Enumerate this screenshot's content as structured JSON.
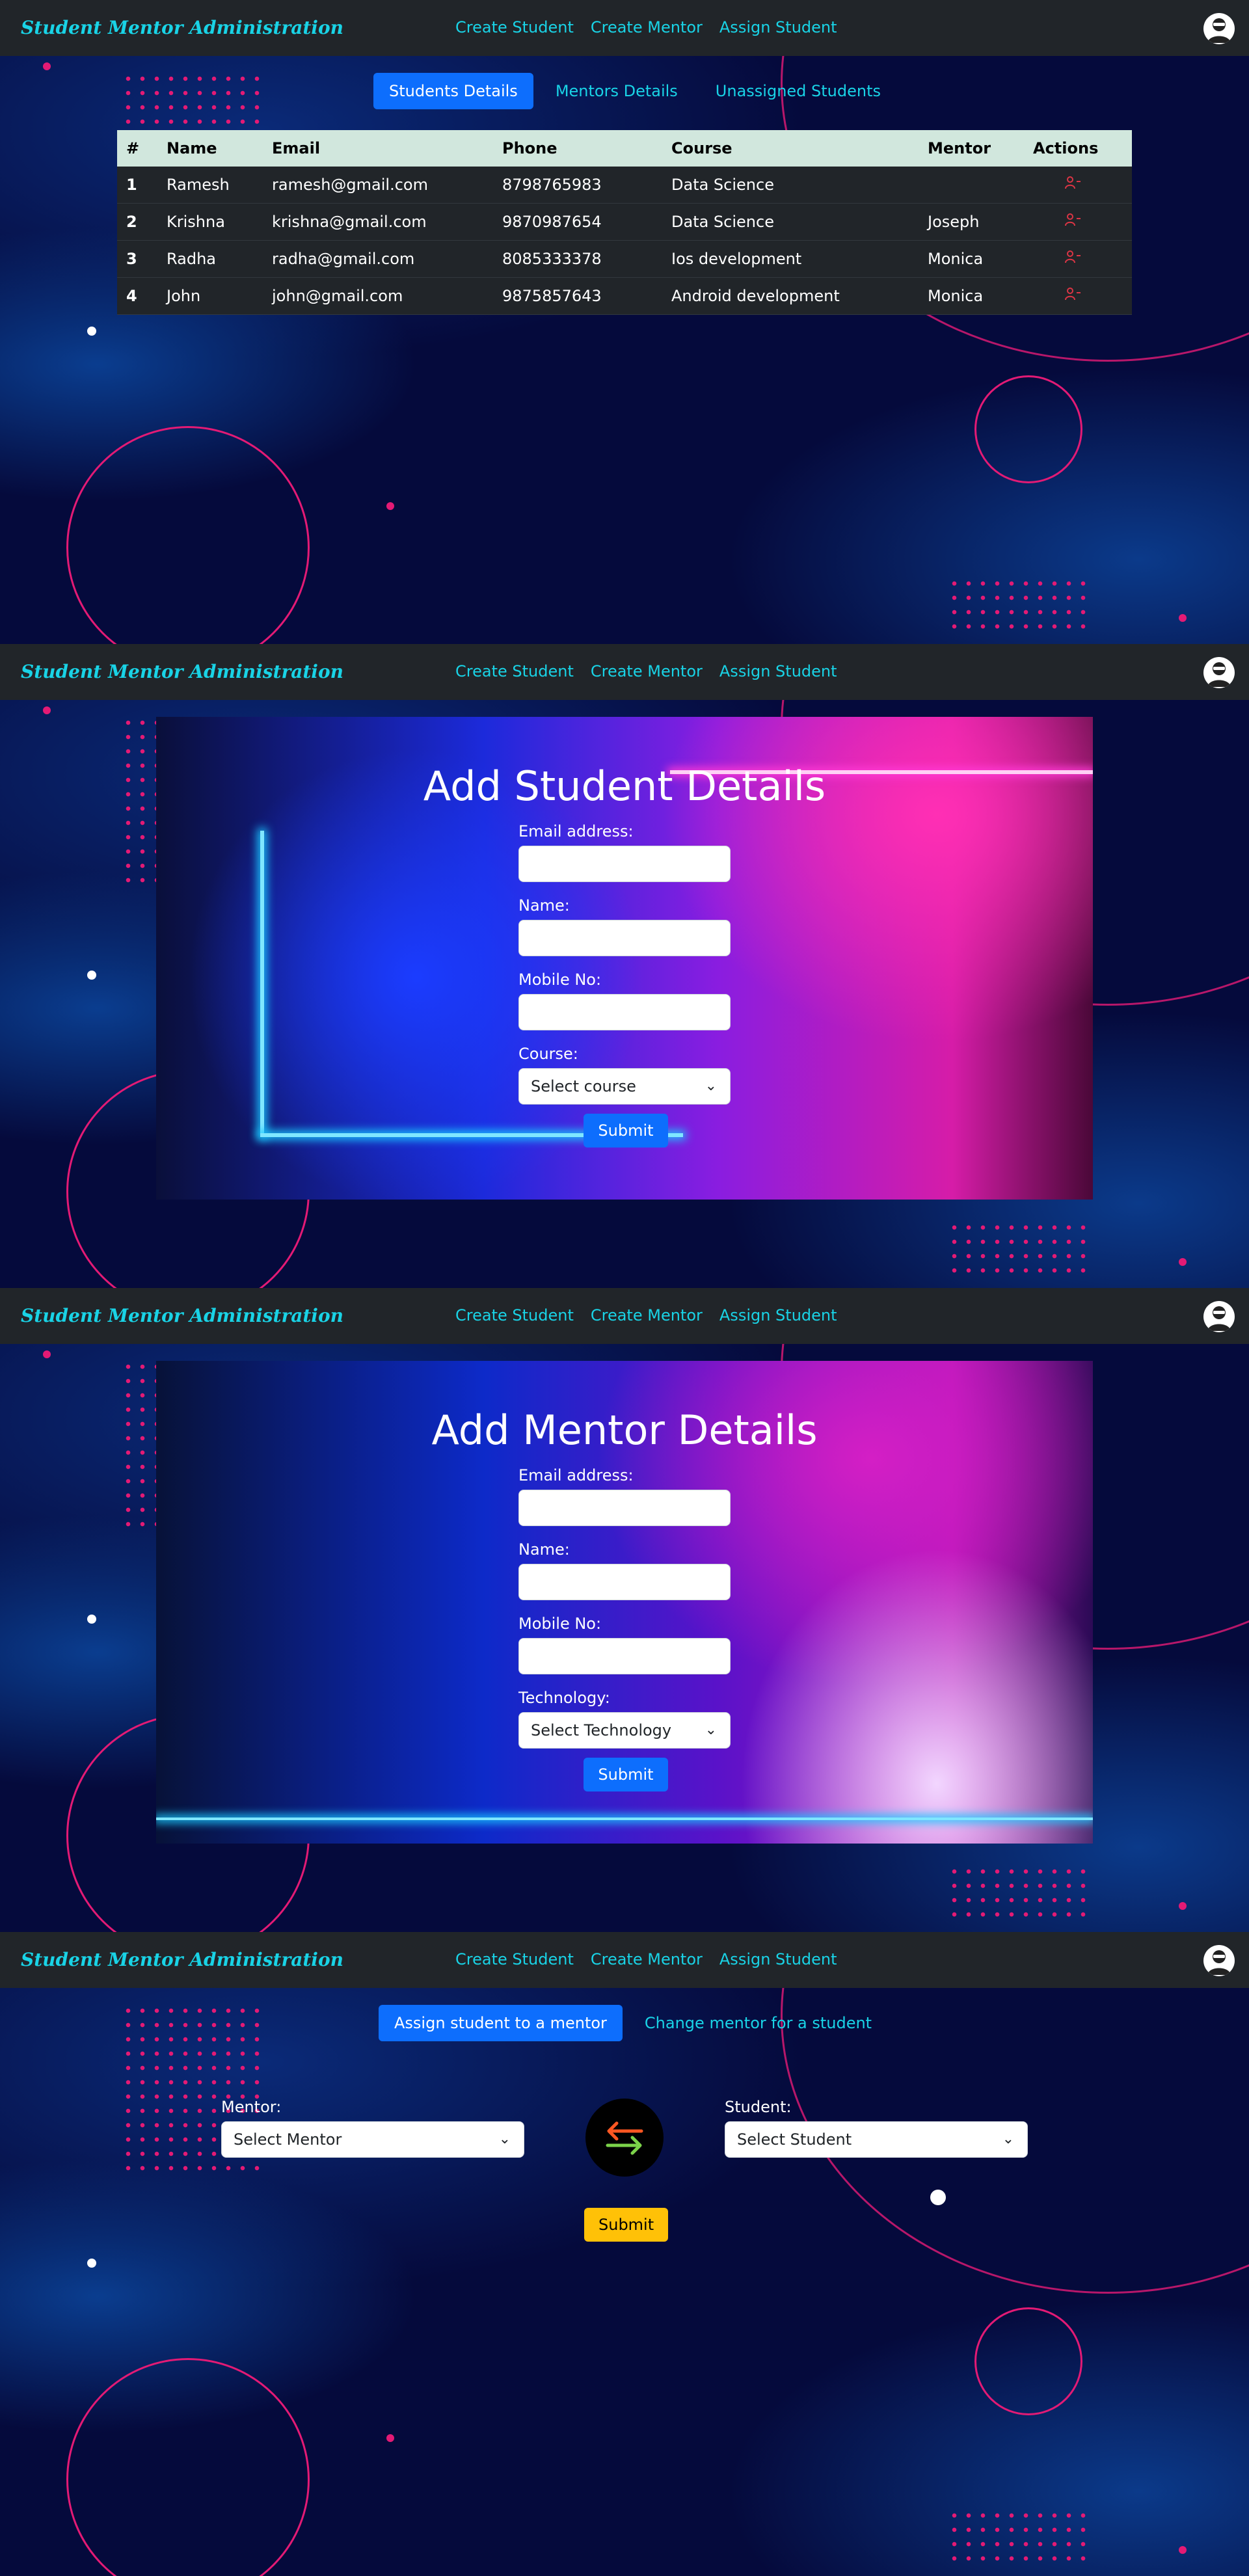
{
  "nav": {
    "brand": "Student Mentor Administration",
    "links": [
      "Create Student",
      "Create Mentor",
      "Assign Student"
    ]
  },
  "students_view": {
    "tabs": [
      "Students Details",
      "Mentors Details",
      "Unassigned Students"
    ],
    "columns": [
      "#",
      "Name",
      "Email",
      "Phone",
      "Course",
      "Mentor",
      "Actions"
    ],
    "rows": [
      {
        "id": "1",
        "name": "Ramesh",
        "email": "ramesh@gmail.com",
        "phone": "8798765983",
        "course": "Data Science",
        "mentor": ""
      },
      {
        "id": "2",
        "name": "Krishna",
        "email": "krishna@gmail.com",
        "phone": "9870987654",
        "course": "Data Science",
        "mentor": "Joseph"
      },
      {
        "id": "3",
        "name": "Radha",
        "email": "radha@gmail.com",
        "phone": "8085333378",
        "course": "Ios development",
        "mentor": "Monica"
      },
      {
        "id": "4",
        "name": "John",
        "email": "john@gmail.com",
        "phone": "9875857643",
        "course": "Android development",
        "mentor": "Monica"
      }
    ],
    "action_icon": "user-remove-icon"
  },
  "student_form": {
    "title": "Add Student Details",
    "email_label": "Email address:",
    "name_label": "Name:",
    "mobile_label": "Mobile No:",
    "course_label": "Course:",
    "course_select": "Select course",
    "submit": "Submit"
  },
  "mentor_form": {
    "title": "Add Mentor Details",
    "email_label": "Email address:",
    "name_label": "Name:",
    "mobile_label": "Mobile No:",
    "tech_label": "Technology:",
    "tech_select": "Select Technology",
    "submit": "Submit"
  },
  "assign_view": {
    "tabs": [
      "Assign student to a mentor",
      "Change mentor for a student"
    ],
    "mentor_label": "Mentor:",
    "mentor_select": "Select Mentor",
    "student_label": "Student:",
    "student_select": "Select Student",
    "submit": "Submit",
    "swap_icon": "swap-arrows-icon"
  },
  "colors": {
    "accent": "#19d3e6",
    "primary": "#0d6efd",
    "warning": "#ffc107",
    "danger": "#dc3545",
    "navbar": "#212529",
    "header_row": "#d1e7dd",
    "decor_pink": "#e31a75"
  }
}
